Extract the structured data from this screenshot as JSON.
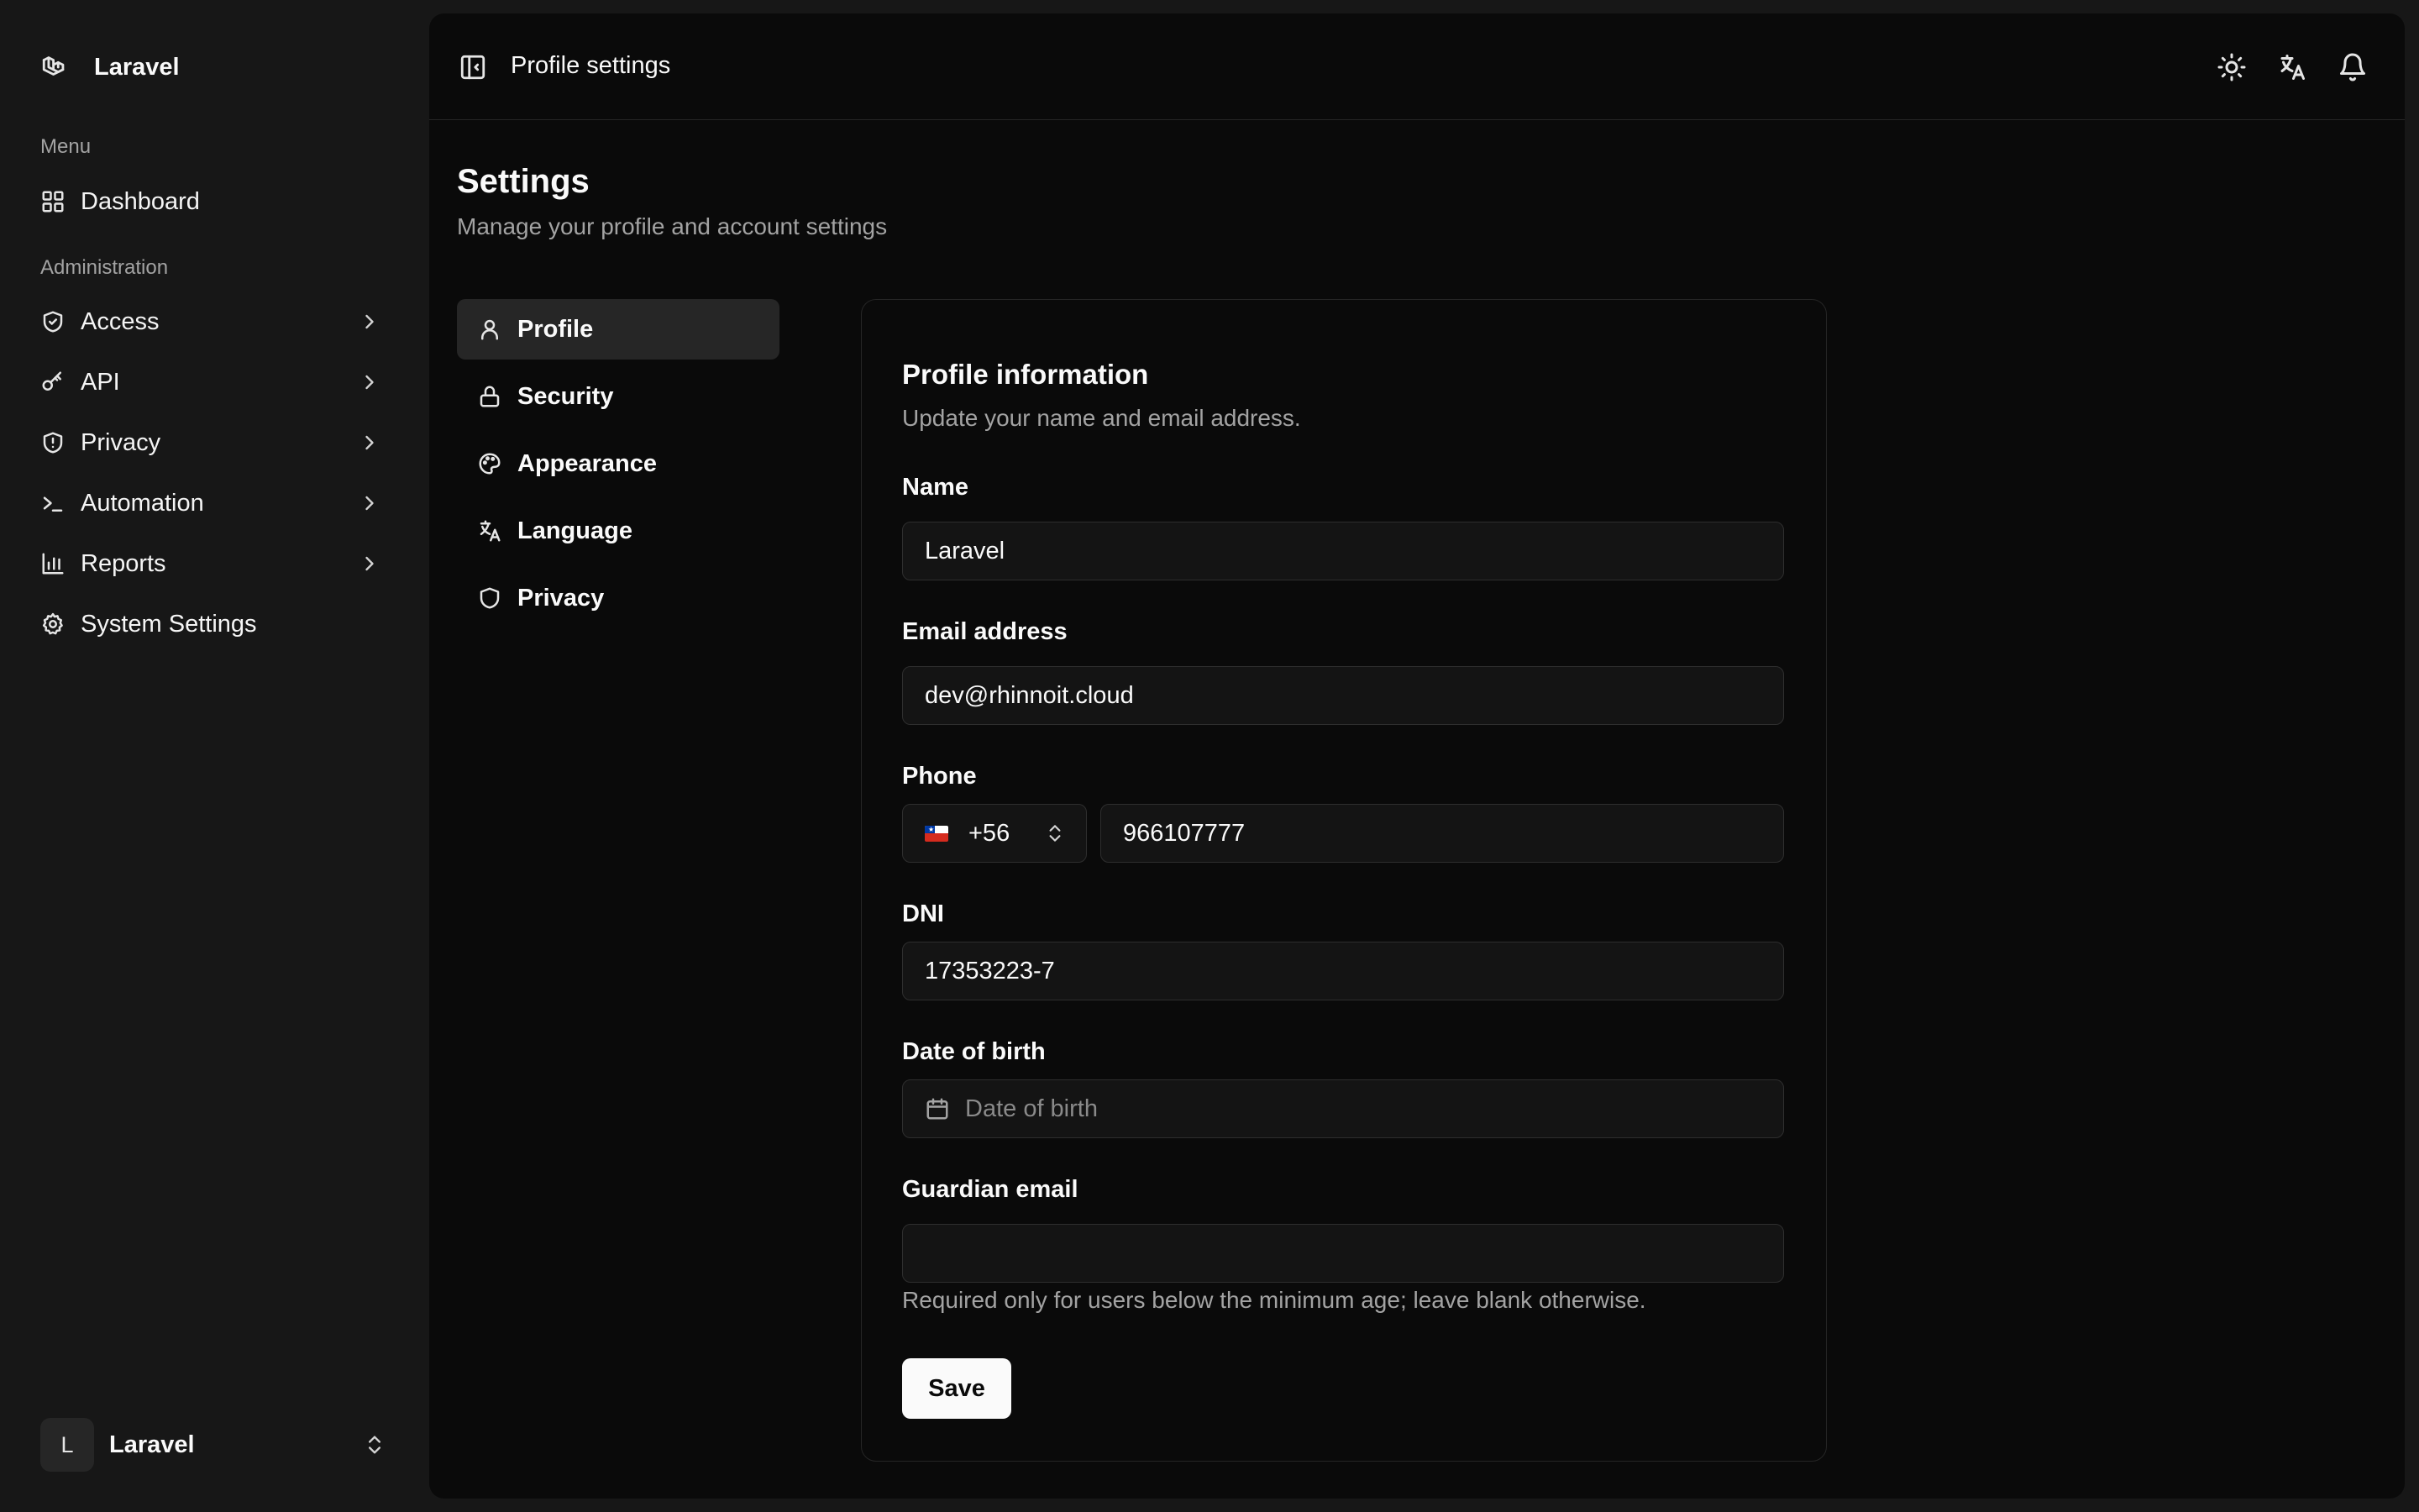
{
  "sidebar": {
    "brand": "Laravel",
    "menu_label": "Menu",
    "admin_label": "Administration",
    "dashboard": "Dashboard",
    "items": [
      {
        "label": "Access"
      },
      {
        "label": "API"
      },
      {
        "label": "Privacy"
      },
      {
        "label": "Automation"
      },
      {
        "label": "Reports"
      }
    ],
    "system_settings": "System Settings",
    "user": {
      "initial": "L",
      "name": "Laravel"
    }
  },
  "topbar": {
    "title": "Profile settings"
  },
  "page": {
    "title": "Settings",
    "subtitle": "Manage your profile and account settings"
  },
  "settings_nav": [
    {
      "label": "Profile",
      "active": true
    },
    {
      "label": "Security"
    },
    {
      "label": "Appearance"
    },
    {
      "label": "Language"
    },
    {
      "label": "Privacy"
    }
  ],
  "profile": {
    "title": "Profile information",
    "subtitle": "Update your name and email address.",
    "name_label": "Name",
    "name_value": "Laravel",
    "email_label": "Email address",
    "email_value": "dev@rhinnoit.cloud",
    "phone_label": "Phone",
    "phone_code": "+56",
    "phone_number": "966107777",
    "dni_label": "DNI",
    "dni_value": "17353223-7",
    "dob_label": "Date of birth",
    "dob_placeholder": "Date of birth",
    "guardian_label": "Guardian email",
    "guardian_value": "",
    "guardian_help": "Required only for users below the minimum age; leave blank otherwise.",
    "save": "Save"
  },
  "colors": {
    "background": "#171717",
    "panel": "#0a0a0a",
    "accent": "#fafafa",
    "muted": "#a3a3a3"
  }
}
